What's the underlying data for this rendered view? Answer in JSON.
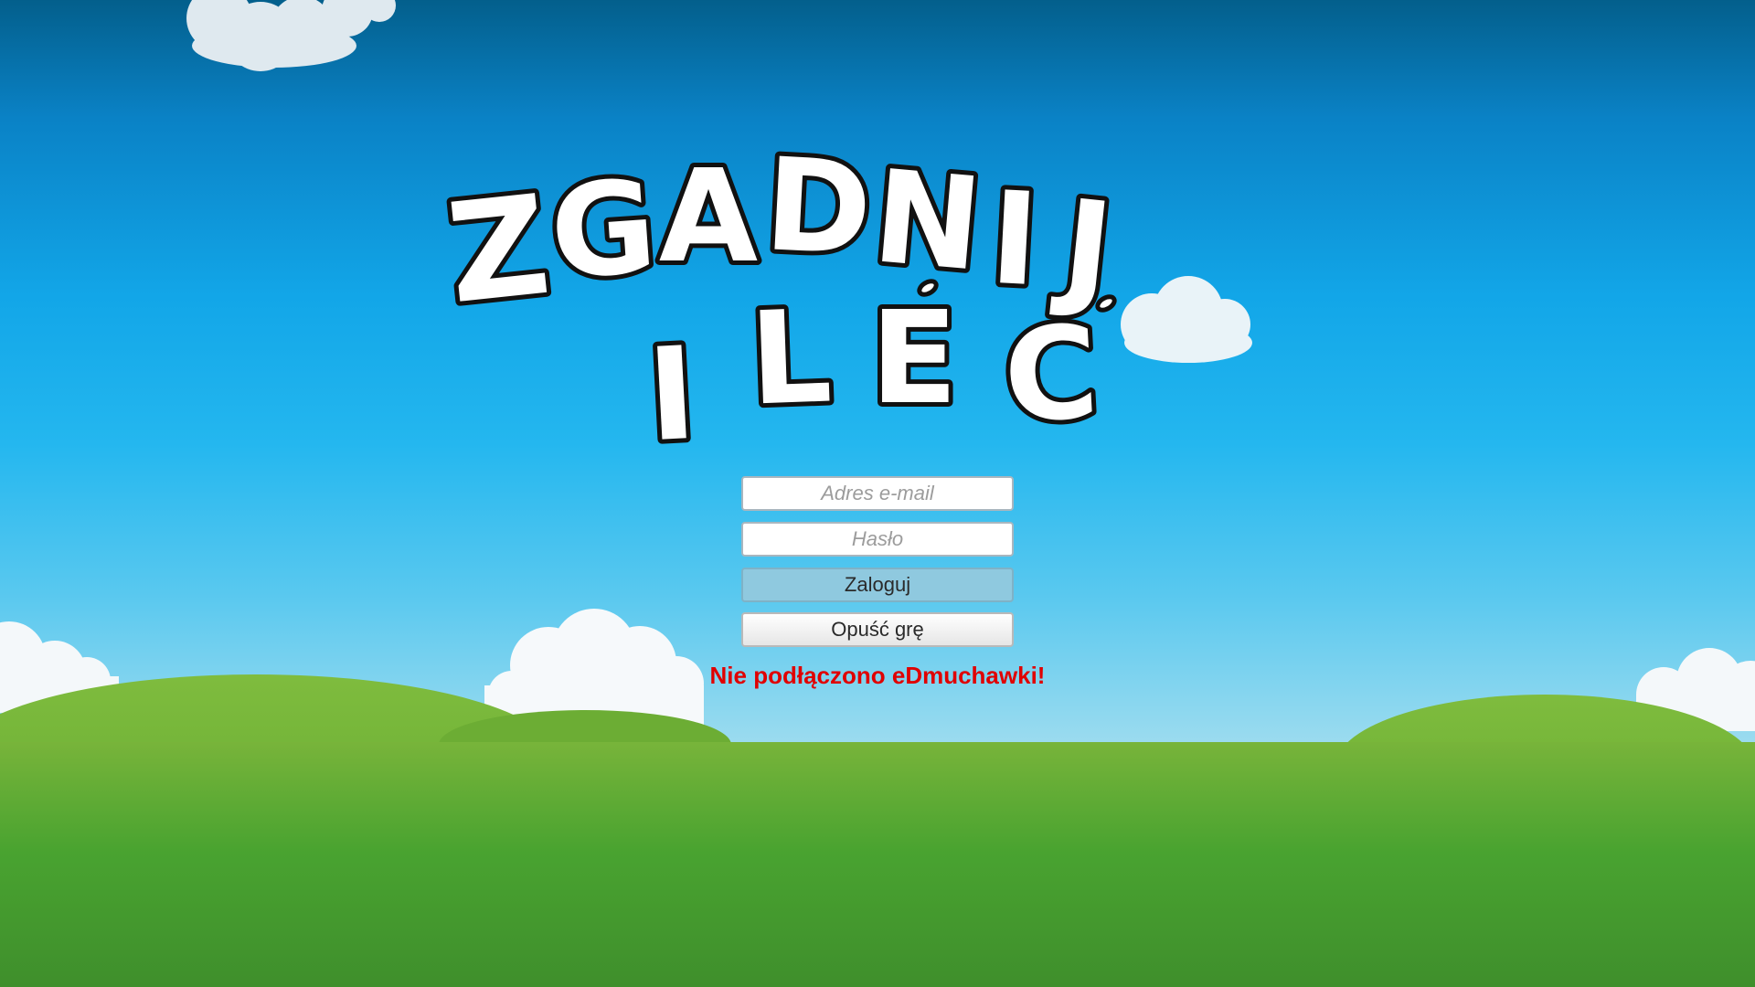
{
  "game": {
    "title_line1": "ZGADNIJ",
    "title_line2": "I LEĆ"
  },
  "login": {
    "email_placeholder": "Adres e-mail",
    "password_placeholder": "Hasło",
    "login_button": "Zaloguj",
    "quit_button": "Opuść grę"
  },
  "status": {
    "message": "Nie podłączono eDmuchawki!",
    "color": "#e00000"
  },
  "colors": {
    "sky_top": "#035f8c",
    "sky_bottom": "#b4e3ef",
    "grass": "#5ea82c",
    "cloud": "#ffffff"
  }
}
